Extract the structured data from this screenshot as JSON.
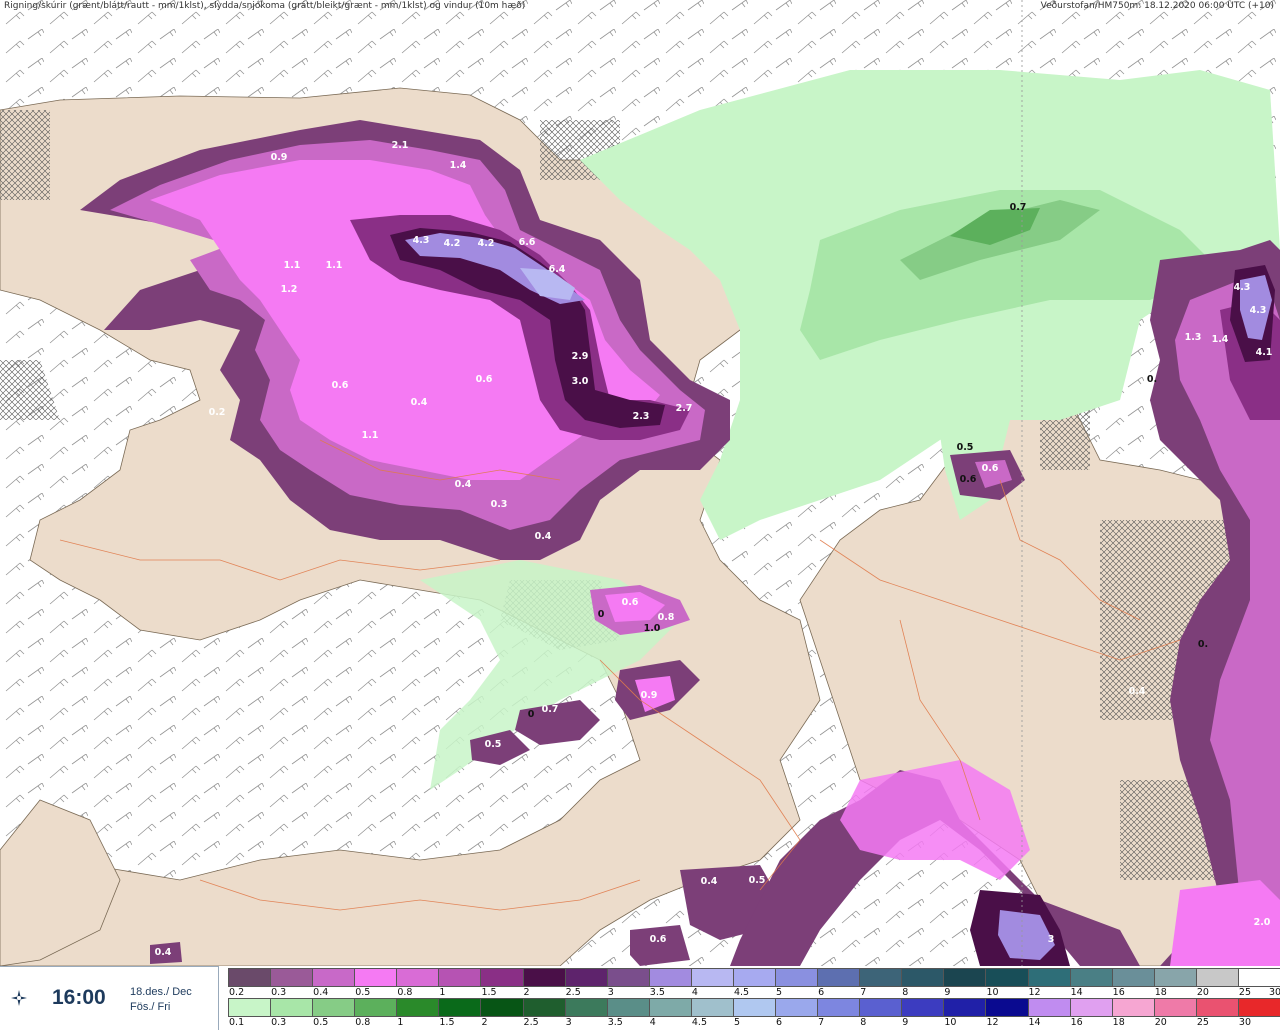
{
  "header": {
    "left": "Rigning/skúrir (grænt/blátt/rautt - mm/1klst), slydda/snjókoma (grátt/bleikt/grænt - mm/1klst) og vindur (10m hæð)",
    "right": "Veðurstofan/HM750m: 18.12.2020 06:00 UTC (+10)"
  },
  "time_panel": {
    "icon": "compass-icon",
    "time": "16:00",
    "date_line1": "18.des./ Dec",
    "date_line2": "Fös./ Fri"
  },
  "legend": {
    "snow_scale": {
      "colors": [
        "#6a4a6a",
        "#9a5a98",
        "#c869c8",
        "#f57af3",
        "#d96cd6",
        "#b653b3",
        "#8a2f86",
        "#4a0f48",
        "#5e236c",
        "#7a4e8c",
        "#a28be0",
        "#b8b8f2",
        "#a7aaf0",
        "#8a90e0",
        "#5d6fb0",
        "#3d6478",
        "#2c5868",
        "#1b4550",
        "#184e58",
        "#2e6e78",
        "#4a7f85",
        "#6a8f99",
        "#88a5aa",
        "#c8c8c8",
        "#ffffff"
      ],
      "labels": [
        "0.2",
        "0.3",
        "0.4",
        "0.5",
        "0.8",
        "1",
        "1.5",
        "2",
        "2.5",
        "3",
        "3.5",
        "4",
        "4.5",
        "5",
        "6",
        "7",
        "8",
        "9",
        "10",
        "12",
        "14",
        "16",
        "18",
        "20",
        "25",
        "30"
      ]
    },
    "rain_scale": {
      "colors": [
        "#c8f5c8",
        "#a8e6a8",
        "#86cc86",
        "#5cb05c",
        "#2a8a2a",
        "#0a6a1a",
        "#075515",
        "#1f5e2e",
        "#3c7a5c",
        "#5a8e88",
        "#7eaaa8",
        "#a0c0cc",
        "#b0c8f0",
        "#9aa8ec",
        "#7d86e0",
        "#5a60d0",
        "#3c3cc0",
        "#2020a8",
        "#0a0a90",
        "#c08cf0",
        "#e0a0f0",
        "#f6a6d2",
        "#ef7aa8",
        "#ea5270",
        "#e8282a"
      ],
      "labels": [
        "0.1",
        "0.3",
        "0.5",
        "0.8",
        "1",
        "1.5",
        "2",
        "2.5",
        "3",
        "3.5",
        "4",
        "4.5",
        "5",
        "6",
        "7",
        "8",
        "9",
        "10",
        "12",
        "14",
        "16",
        "18",
        "20",
        "25",
        "30"
      ]
    }
  },
  "map": {
    "labels": [
      {
        "text": "2.1",
        "color": "#ffffff"
      },
      {
        "text": "0.9",
        "color": "#ffffff"
      },
      {
        "text": "1.4",
        "color": "#ffffff"
      },
      {
        "text": "4.3",
        "color": "#ffffff"
      },
      {
        "text": "4.2",
        "color": "#ffffff"
      },
      {
        "text": "4.2",
        "color": "#ffffff"
      },
      {
        "text": "6.6",
        "color": "#ffffff"
      },
      {
        "text": "6.4",
        "color": "#ffffff"
      },
      {
        "text": "1.1",
        "color": "#ffffff"
      },
      {
        "text": "1.1",
        "color": "#ffffff"
      },
      {
        "text": "1.2",
        "color": "#ffffff"
      },
      {
        "text": "2.9",
        "color": "#ffffff"
      },
      {
        "text": "3.0",
        "color": "#ffffff"
      },
      {
        "text": "2.3",
        "color": "#ffffff"
      },
      {
        "text": "2.7",
        "color": "#ffffff"
      },
      {
        "text": "0.6",
        "color": "#ffffff"
      },
      {
        "text": "0.4",
        "color": "#ffffff"
      },
      {
        "text": "0.6",
        "color": "#ffffff"
      },
      {
        "text": "0.2",
        "color": "#ffffff"
      },
      {
        "text": "1.1",
        "color": "#ffffff"
      },
      {
        "text": "0.4",
        "color": "#ffffff"
      },
      {
        "text": "0.3",
        "color": "#ffffff"
      },
      {
        "text": "0.4",
        "color": "#ffffff"
      },
      {
        "text": "0.7",
        "color": "#111111"
      },
      {
        "text": "4.3",
        "color": "#ffffff"
      },
      {
        "text": "4.3",
        "color": "#ffffff"
      },
      {
        "text": "4.1",
        "color": "#ffffff"
      },
      {
        "text": "1.3",
        "color": "#ffffff"
      },
      {
        "text": "1.4",
        "color": "#ffffff"
      },
      {
        "text": "0.",
        "color": "#111111"
      },
      {
        "text": "0.5",
        "color": "#111111"
      },
      {
        "text": "0.6",
        "color": "#ffffff"
      },
      {
        "text": "0.6",
        "color": "#111111"
      },
      {
        "text": "0.6",
        "color": "#ffffff"
      },
      {
        "text": "0",
        "color": "#111111"
      },
      {
        "text": "0.8",
        "color": "#ffffff"
      },
      {
        "text": "1.0",
        "color": "#111111"
      },
      {
        "text": "0.9",
        "color": "#ffffff"
      },
      {
        "text": "0.7",
        "color": "#ffffff"
      },
      {
        "text": "0",
        "color": "#111111"
      },
      {
        "text": "0.5",
        "color": "#ffffff"
      },
      {
        "text": "0.4",
        "color": "#ffffff"
      },
      {
        "text": "0.",
        "color": "#111111"
      },
      {
        "text": "0.4",
        "color": "#ffffff"
      },
      {
        "text": "0.5",
        "color": "#ffffff"
      },
      {
        "text": "0.6",
        "color": "#ffffff"
      },
      {
        "text": "0.4",
        "color": "#ffffff"
      },
      {
        "text": "2.0",
        "color": "#ffffff"
      },
      {
        "text": "3",
        "color": "#ffffff"
      }
    ]
  }
}
